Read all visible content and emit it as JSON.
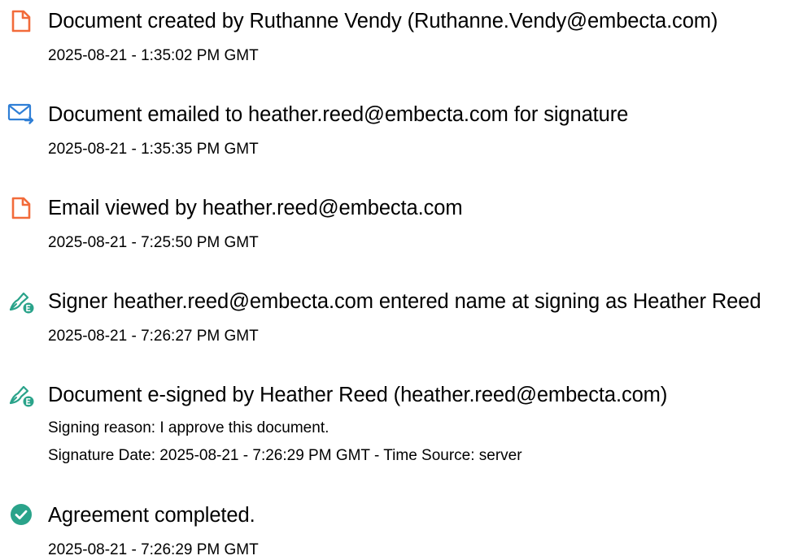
{
  "events": [
    {
      "icon": "document-created-icon",
      "title": "Document created by Ruthanne Vendy (Ruthanne.Vendy@embecta.com)",
      "details": [
        "2025-08-21 - 1:35:02 PM GMT"
      ]
    },
    {
      "icon": "email-sent-icon",
      "title": "Document emailed to heather.reed@embecta.com for signature",
      "details": [
        "2025-08-21 - 1:35:35 PM GMT"
      ]
    },
    {
      "icon": "document-viewed-icon",
      "title": "Email viewed by heather.reed@embecta.com",
      "details": [
        "2025-08-21 - 7:25:50 PM GMT"
      ]
    },
    {
      "icon": "e-sign-pen-icon",
      "title": "Signer heather.reed@embecta.com entered name at signing as Heather Reed",
      "details": [
        "2025-08-21 - 7:26:27 PM GMT"
      ]
    },
    {
      "icon": "e-sign-pen-icon",
      "title": "Document e-signed by Heather Reed (heather.reed@embecta.com)",
      "details": [
        "Signing reason: I approve this document.",
        "Signature Date: 2025-08-21 - 7:26:29 PM GMT - Time Source: server"
      ]
    },
    {
      "icon": "check-circle-icon",
      "title": "Agreement completed.",
      "details": [
        "2025-08-21 - 7:26:29 PM GMT"
      ]
    }
  ],
  "colors": {
    "document_icon": "#F26B3A",
    "email_icon": "#2F7FD6",
    "sign_icon": "#2AA38A",
    "check_icon": "#2AA38A",
    "text": "#000000"
  }
}
